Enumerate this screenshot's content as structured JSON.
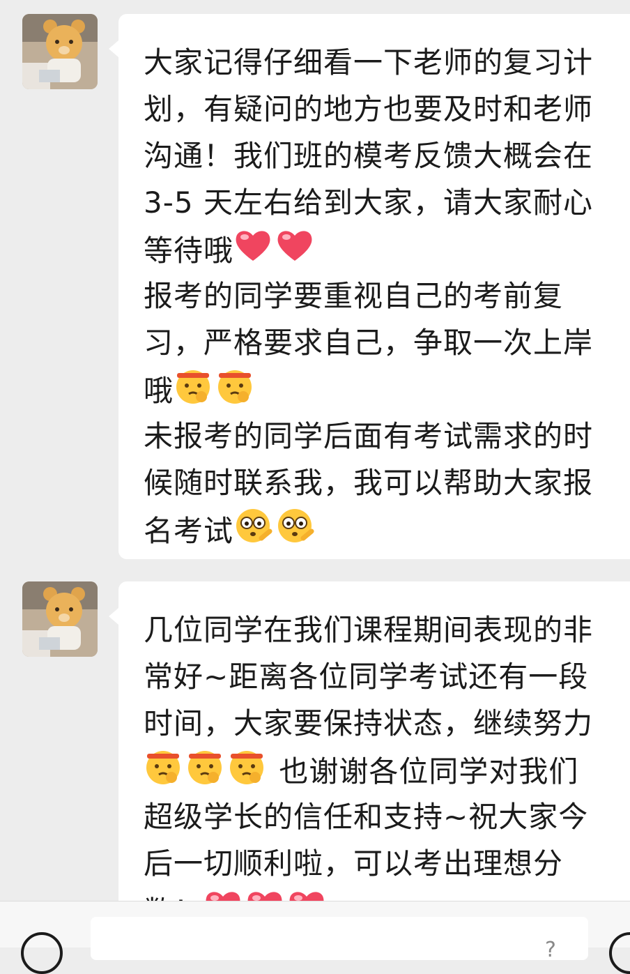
{
  "messages": [
    {
      "avatar_icon": "teddy-bear-avatar-icon",
      "lines": [
        "大家记得仔细看一下老师的复习计",
        "划，有疑问的地方也要及时和老师",
        "沟通！我们班的模考反馈大概会在",
        "3-5 天左右给到大家，请大家耐心",
        "等待哦",
        "报考的同学要重视自己的考前复",
        "习，严格要求自己，争取一次上岸",
        "哦",
        "未报考的同学后面有考试需求的时",
        "候随时联系我，我可以帮助大家报",
        "名考试"
      ]
    },
    {
      "avatar_icon": "teddy-bear-avatar-icon",
      "lines": [
        "几位同学在我们课程期间表现的非",
        "常好~距离各位同学考试还有一段",
        "时间，大家要保持状态，继续努力",
        " 也谢谢各位同学对我们",
        "超级学长的信任和支持~祝大家今",
        "后一切顺利啦，可以考出理想分",
        "数！"
      ]
    }
  ],
  "colors": {
    "background": "#ededed",
    "bubble": "#ffffff",
    "text": "#1b1b1b",
    "heart": "#f0455f",
    "emoji_face": "#ffc83d",
    "headband": "#e8502c"
  },
  "bottom_bar": {
    "voice_icon": "voice-input-icon",
    "emoji_icon": "emoji-picker-icon",
    "input_value": "",
    "input_glyph": "?"
  }
}
